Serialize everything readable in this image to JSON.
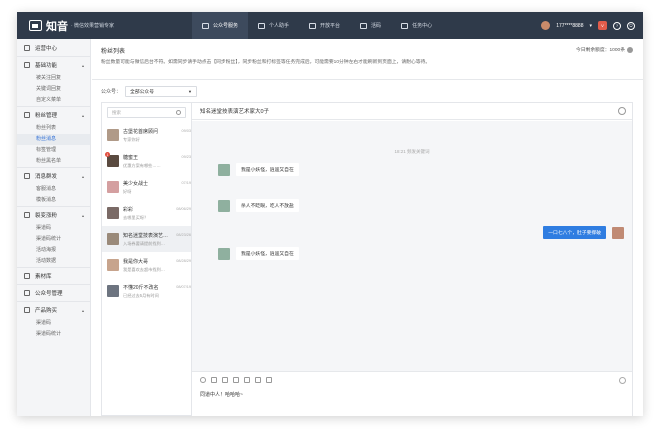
{
  "app": {
    "logo_name": "知音",
    "logo_sub": "· 微信效果营销专家"
  },
  "topnav": [
    {
      "label": "公众号服务",
      "active": true
    },
    {
      "label": "个人助手",
      "active": false
    },
    {
      "label": "开放平台",
      "active": false
    },
    {
      "label": "活码",
      "active": false
    },
    {
      "label": "任务中心",
      "active": false
    }
  ],
  "user": {
    "phone": "177****8888",
    "vip": "V",
    "help": "?",
    "power": "⏻"
  },
  "sidebar": {
    "top": "运营中心",
    "groups": [
      {
        "label": "基础功能",
        "items": [
          "被关注回复",
          "关键词回复",
          "自定义菜单"
        ]
      },
      {
        "label": "粉丝管理",
        "items": [
          "粉丝列表",
          "粉丝消息",
          "标签管理",
          "粉丝黑名单"
        ]
      },
      {
        "label": "消息群发",
        "items": [
          "客服消息",
          "模板消息"
        ]
      },
      {
        "label": "裂变涨粉",
        "items": [
          "渠道码",
          "渠道码统计",
          "活动海报",
          "活动数据"
        ]
      },
      {
        "label": "素材库",
        "items": []
      },
      {
        "label": "公众号管理",
        "items": []
      },
      {
        "label": "产品购买",
        "items": [
          "渠道码",
          "渠道码统计"
        ]
      }
    ],
    "active_item": "粉丝消息"
  },
  "header": {
    "title": "粉丝列表",
    "description": "粉丝数量可能与微信后台不符。如需同步请手动点击【同步粉丝】，同步粉丝和打标签等任务完成后，可能需要10分钟左右才能刷新到页面上，请耐心等待。",
    "quota": "今日剩余额度：1000条"
  },
  "account": {
    "label": "公众号：",
    "selected": "全部公众号"
  },
  "search": {
    "placeholder": "搜索"
  },
  "conversations": [
    {
      "name": "古堡花首席顾问",
      "msg": "专家你好",
      "time": "09/03",
      "color": "#b09a88",
      "badge": ""
    },
    {
      "name": "糖蜜王",
      "msg": "优惠方案有哪些……",
      "time": "09/23",
      "color": "#5a4a40",
      "badge": "1"
    },
    {
      "name": "美少女战士",
      "msg": "好呀",
      "time": "07/19",
      "color": "#d49fa0",
      "badge": ""
    },
    {
      "name": "彩彩",
      "msg": "去哪里买呀？",
      "time": "08/06/29",
      "color": "#7a6a66",
      "badge": ""
    },
    {
      "name": "知名迷堂技表演艺…",
      "msg": "入场券要请提前找到…",
      "time": "08/23/26",
      "color": "#9a8a7a",
      "badge": ""
    },
    {
      "name": "我是你大哥",
      "msg": "我是喜欢去超市找到…",
      "time": "08/28/29",
      "color": "#c7a48d",
      "badge": ""
    },
    {
      "name": "不懂20斤不改名",
      "msg": "已经过去5月有时间",
      "time": "08/07/19",
      "color": "#6d7480",
      "badge": ""
    }
  ],
  "chat": {
    "title": "知名迷堂技表演艺术家大0子",
    "timestamp": "18:21 频发关键词",
    "messages": [
      {
        "text": "我是小妖怪，逍遥又自在",
        "dir": "in"
      },
      {
        "text": "杀人不眨眼，吃人不放盐",
        "dir": "in"
      },
      {
        "text": "一口七八个，肚子要撑破",
        "dir": "out"
      },
      {
        "text": "我是小妖怪，逍遥又自在",
        "dir": "in"
      }
    ],
    "draft": "同道中人！哈哈哈~"
  },
  "colors": {
    "topbar": "#2f3a4a",
    "accent": "#2f7de1",
    "badge": "#e04b3c"
  }
}
